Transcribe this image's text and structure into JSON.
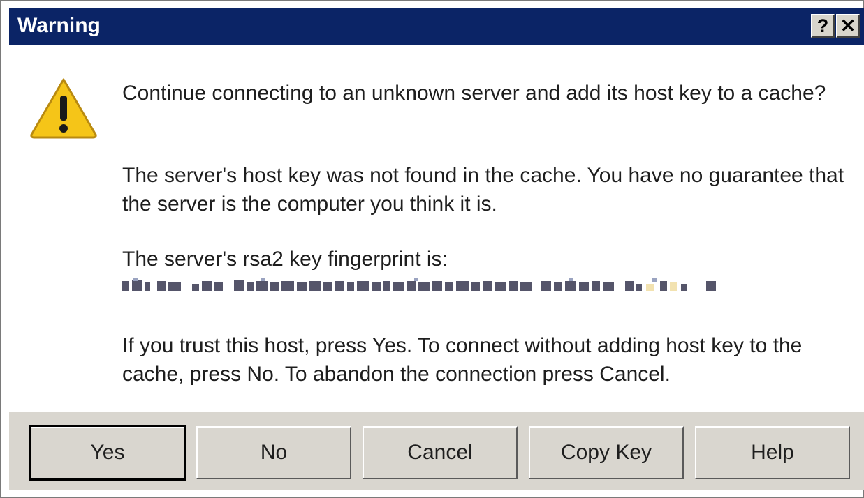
{
  "window": {
    "title": "Warning"
  },
  "titlebar": {
    "help_label": "?",
    "close_label": "✕"
  },
  "colors": {
    "titlebar": "#0b2466",
    "warning_icon": "#f5c518",
    "button_face": "#d9d6cf"
  },
  "message": {
    "question": "Continue connecting to an unknown server and add its host key to a cache?",
    "explanation": "The server's host key was not found in the cache. You have no guarantee that the server is the computer you think it is.",
    "fingerprint_label": "The server's rsa2 key fingerprint is:",
    "instructions": "If you trust this host, press Yes. To connect without adding host key to the cache, press No. To abandon the connection press Cancel."
  },
  "buttons": {
    "yes": "Yes",
    "no": "No",
    "cancel": "Cancel",
    "copy_key": "Copy Key",
    "help": "Help"
  },
  "icons": {
    "warning": "warning-icon",
    "fingerprint": "redacted-fingerprint"
  }
}
